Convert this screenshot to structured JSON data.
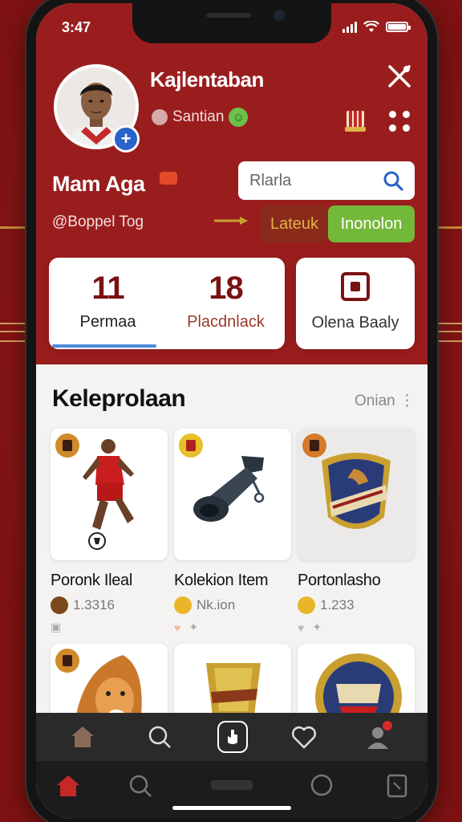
{
  "status": {
    "time": "3:47"
  },
  "profile": {
    "app_title": "Kajlentaban",
    "sub_name": "Santian",
    "user_name": "Mam Aga",
    "handle": "@Boppel Tog"
  },
  "search": {
    "placeholder": "Rlarla"
  },
  "actions": {
    "latest_label": "Lateuk",
    "follow_label": "Inonolon"
  },
  "stats": [
    {
      "value": "11",
      "label": "Permaa"
    },
    {
      "value": "18",
      "label": "Placdnlack"
    }
  ],
  "side_card": {
    "label": "Olena Baaly"
  },
  "section": {
    "title": "Keleprolaan",
    "more_label": "Onian ⋮"
  },
  "cards": [
    {
      "name": "Poronk Ileal",
      "meta": "1.3316"
    },
    {
      "name": "Kolekion Item",
      "meta": "Nk.ion"
    },
    {
      "name": "Portonlasho",
      "meta": "1.233"
    }
  ],
  "colors": {
    "brand_red": "#9a1d1d",
    "accent_green": "#74b83a",
    "accent_blue": "#2a63c9",
    "gold": "#e0b24a"
  }
}
